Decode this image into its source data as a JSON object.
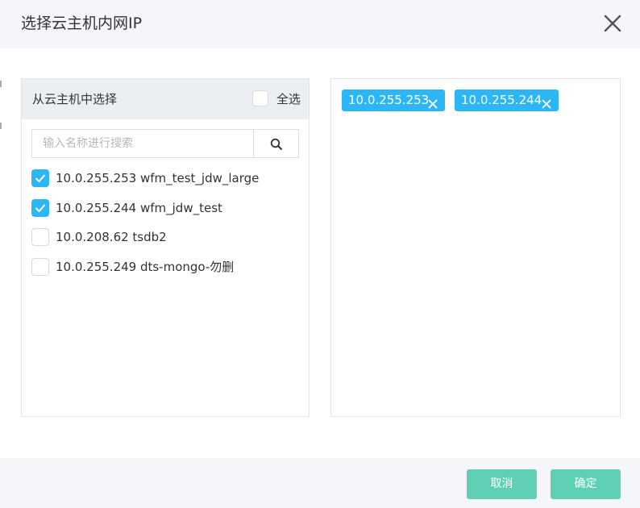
{
  "dialog": {
    "title": "选择云主机内网IP",
    "close_icon": "close-icon"
  },
  "left_panel": {
    "title": "从云主机中选择",
    "select_all_label": "全选",
    "select_all_checked": false,
    "search": {
      "placeholder": "输入名称进行搜索",
      "value": "",
      "icon": "search-icon"
    },
    "items": [
      {
        "label": "10.0.255.253 wfm_test_jdw_large",
        "checked": true
      },
      {
        "label": "10.0.255.244 wfm_jdw_test",
        "checked": true
      },
      {
        "label": "10.0.208.62 tsdb2",
        "checked": false
      },
      {
        "label": "10.0.255.249 dts-mongo-勿删",
        "checked": false
      }
    ]
  },
  "right_panel": {
    "selected_tags": [
      {
        "label": "10.0.255.253"
      },
      {
        "label": "10.0.255.244"
      }
    ]
  },
  "footer": {
    "cancel_label": "取消",
    "confirm_label": "确定"
  },
  "colors": {
    "accent": "#2db6f5",
    "button": "#5fd0b6",
    "header_bg": "#f4f6f9",
    "panel_head_bg": "#ebeff4"
  }
}
